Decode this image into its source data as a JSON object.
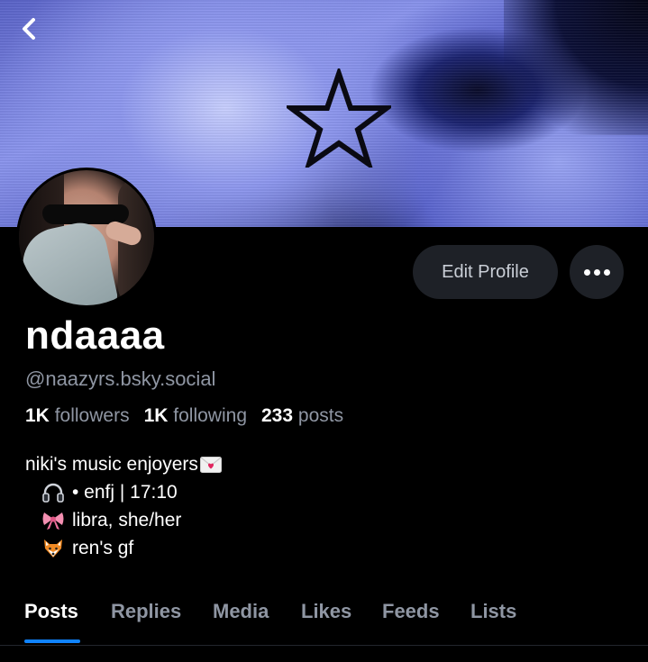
{
  "profile": {
    "display_name": "ndaaaa",
    "handle": "@naazyrs.bsky.social",
    "edit_label": "Edit Profile"
  },
  "stats": {
    "followers_count": "1K",
    "followers_label": "followers",
    "following_count": "1K",
    "following_label": "following",
    "posts_count": "233",
    "posts_label": "posts"
  },
  "bio": {
    "line1": "niki's music enjoyers",
    "line2": "• enfj | 17:10",
    "line3": "libra, she/her",
    "line4": "ren's gf"
  },
  "tabs": [
    {
      "label": "Posts"
    },
    {
      "label": "Replies"
    },
    {
      "label": "Media"
    },
    {
      "label": "Likes"
    },
    {
      "label": "Feeds"
    },
    {
      "label": "Lists"
    }
  ],
  "icons": {
    "back": "chevron-left-icon",
    "more": "ellipsis-icon",
    "headphones": "headphones-emoji",
    "ribbon": "ribbon-emoji",
    "fox": "fox-emoji",
    "envelope": "love-letter-emoji"
  },
  "colors": {
    "accent": "#1083fe",
    "muted_text": "#8f96a3",
    "button_bg": "#1e2127",
    "background": "#000000"
  }
}
